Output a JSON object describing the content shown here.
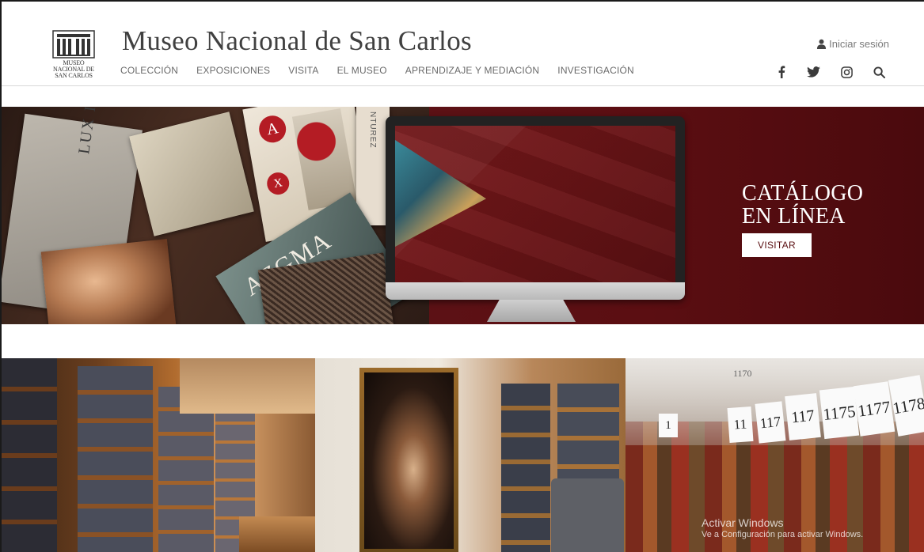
{
  "header": {
    "title": "Museo Nacional de San Carlos",
    "logo_text": [
      "MUSEO",
      "NACIONAL DE",
      "SAN CARLOS"
    ],
    "nav": [
      "COLECCIÓN",
      "EXPOSICIONES",
      "VISITA",
      "EL MUSEO",
      "APRENDIZAJE Y MEDIACIÓN",
      "INVESTIGACIÓN"
    ],
    "login_label": "Iniciar sesión",
    "social_icons": [
      "facebook-icon",
      "twitter-icon",
      "instagram-icon",
      "search-icon"
    ]
  },
  "hero": {
    "title_line1": "CATÁLOGO",
    "title_line2": "EN LÍNEA",
    "button_label": "VISITAR",
    "card_labels": {
      "book_spine": "LUX IN ARCANA",
      "letter": "A",
      "letter_x": "X",
      "vertical_text": "NTUREZ",
      "magazine": "AZGMA"
    }
  },
  "gallery": {
    "tags": [
      "1",
      "11",
      "117",
      "117",
      "1175",
      "1177",
      "1178"
    ],
    "tag_label_1170": "1170"
  },
  "os_watermark": {
    "line1": "Activar Windows",
    "line2": "Ve a Configuración para activar Windows."
  },
  "colors": {
    "hero_bg": "#5a0f12",
    "button_text": "#5a0f12",
    "title_text": "#404040",
    "nav_text": "#6a6a6a"
  }
}
